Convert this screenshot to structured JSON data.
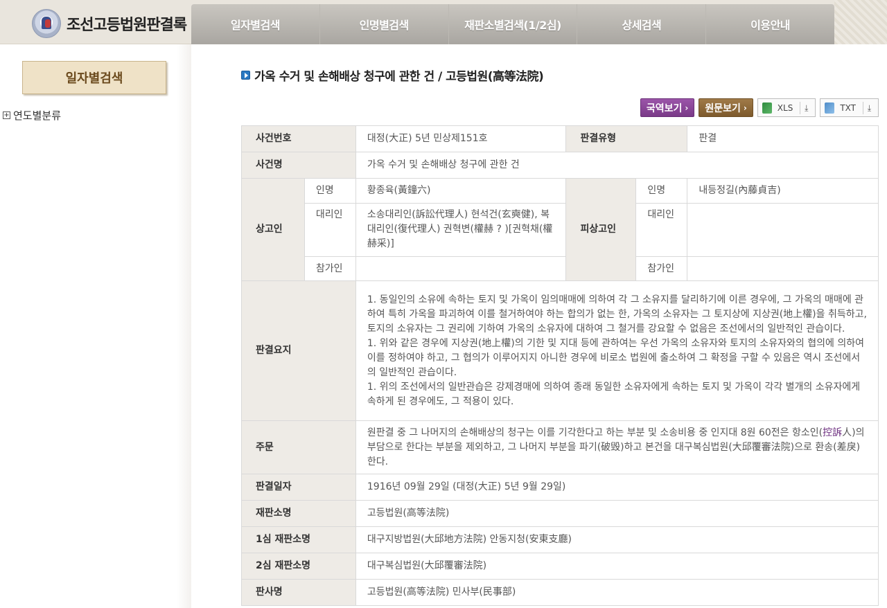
{
  "site": {
    "logo_text": "조선고등법원판결록",
    "nav": [
      "일자별검색",
      "인명별검색",
      "재판소별검색(1/2심)",
      "상세검색",
      "이용안내"
    ]
  },
  "sidebar": {
    "title": "일자별검색",
    "tree_plus": "+",
    "tree_item": "연도별분류"
  },
  "main": {
    "title": "가옥 수거 및 손해배상 청구에 관한 건 /  고등법원(高等法院)",
    "toolbar": {
      "translation": "국역보기",
      "original": "원문보기",
      "arrow": "›",
      "xls": "XLS",
      "txt": "TXT",
      "download_glyph": "⤓"
    },
    "rows": {
      "case_no_label": "사건번호",
      "case_no": "대정(大正) 5년 민상제151호",
      "judg_type_label": "판결유형",
      "judg_type": "판결",
      "case_name_label": "사건명",
      "case_name": "가옥 수거 및 손해배상 청구에 관한 건",
      "appellant_label": "상고인",
      "appellee_label": "피상고인",
      "name_label": "인명",
      "agent_label": "대리인",
      "participant_label": "참가인",
      "appellant_name": "황종육(黃鐘六)",
      "appellant_agent": "소송대리인(訴訟代理人) 현석건(玄奭健), 복대리인(復代理人) 권혁변(權赫 ? )[권혁채(權赫采)]",
      "appellant_participant": "",
      "appellee_name": "내등정길(內藤貞吉)",
      "appellee_agent": "",
      "appellee_participant": "",
      "summary_label": "판결요지",
      "summary": [
        "1. 동일인의 소유에 속하는 토지 및 가옥이 임의매매에 의하여 각 그 소유지를 달리하기에 이른 경우에, 그 가옥의 매매에 관하여 특히 가옥을 파괴하여 이를 철거하여야 하는 합의가 없는 한, 가옥의 소유자는 그 토지상에 지상권(地上權)을 취득하고, 토지의 소유자는 그 권리에 기하여 가옥의 소유자에 대하여 그 철거를 강요할 수 없음은 조선에서의 일반적인 관습이다.",
        "1. 위와 같은 경우에 지상권(地上權)의 기한 및 지대 등에 관하여는 우선 가옥의 소유자와 토지의 소유자와의 협의에 의하여 이를 정하여야 하고, 그 협의가 이루어지지 아니한 경우에 비로소 법원에 출소하여 그 확정을 구할 수 있음은 역시 조선에서의 일반적인 관습이다.",
        "1. 위의 조선에서의 일반관습은 강제경매에 의하여 종래 동일한 소유자에게 속하는 토지 및 가옥이 각각 별개의 소유자에게 속하게 된 경우에도, 그 적용이 있다."
      ],
      "order_label": "주문",
      "order_pre": "원판결 중 그 나머지의 손해배상의 청구는 이를 기각한다고 하는 부분 및 소송비용 중 인지대 8원 60전은 항소인(",
      "order_hl": "控訴",
      "order_post": "人)의 부담으로 한다는 부분을 제외하고, 그 나머지 부분을 파기(破毁)하고 본건을 대구복심법원(大邱覆審法院)으로 환송(差戾)한다.",
      "date_label": "판결일자",
      "date": "1916년 09월 29일 (대정(大正) 5년 9월 29일)",
      "court_label": "재판소명",
      "court": "고등법원(高等法院)",
      "court1_label": "1심 재판소명",
      "court1": "대구지방법원(大邱地方法院) 안동지청(安東支廳)",
      "court2_label": "2심 재판소명",
      "court2": "대구복심법원(大邱覆審法院)",
      "judge_label": "판사명",
      "judge": "고등법원(高等法院) 민사부(民事部)"
    }
  }
}
